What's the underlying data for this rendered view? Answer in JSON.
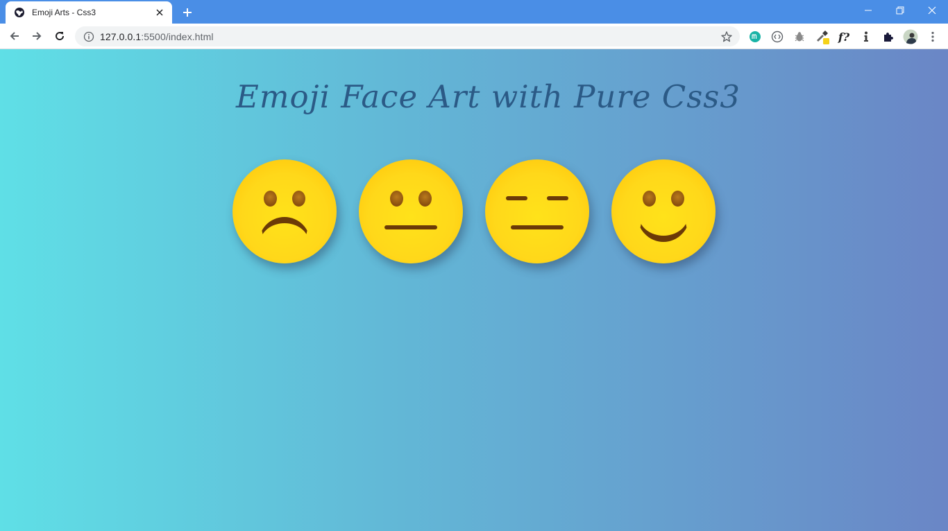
{
  "browser": {
    "tab": {
      "title": "Emoji Arts - Css3"
    },
    "address": {
      "url_host": "127.0.0.1",
      "url_rest": ":5500/index.html"
    },
    "extensions": [
      "m-extension-icon",
      "code-icon",
      "bug-icon",
      "eyedropper-icon",
      "font-question-icon",
      "info-person-icon",
      "puzzle-icon",
      "profile-avatar"
    ]
  },
  "page": {
    "title": "Emoji Face Art with Pure Css3",
    "background_colors": [
      "#5fdfe6",
      "#6a86c6"
    ],
    "emojis": [
      {
        "name": "sad-face",
        "mouth": "frown"
      },
      {
        "name": "neutral-face",
        "mouth": "straight"
      },
      {
        "name": "expressionless-face",
        "mouth": "straight"
      },
      {
        "name": "smiling-face",
        "mouth": "smile"
      }
    ],
    "face_color": "#ffd81a",
    "feature_color": "#6b3a07"
  }
}
